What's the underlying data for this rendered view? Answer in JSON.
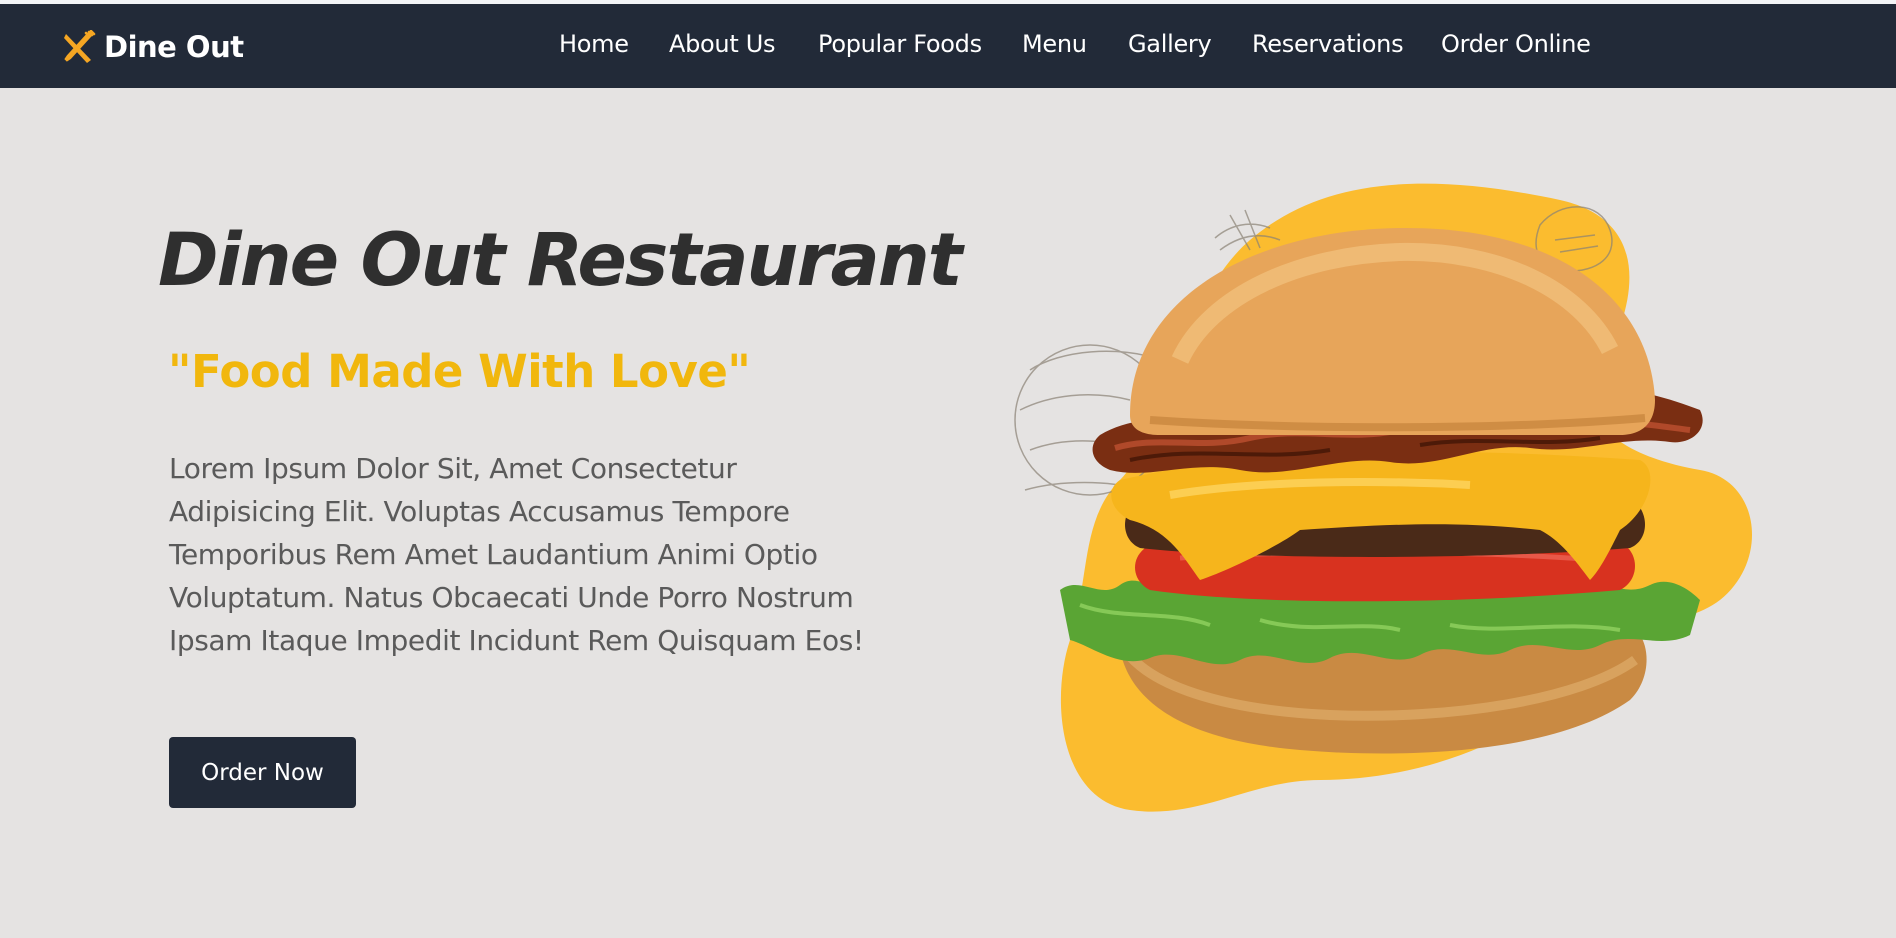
{
  "brand": {
    "name": "Dine Out",
    "icon": "fork-knife-icon",
    "icon_color": "#f5a623"
  },
  "nav": {
    "items": [
      {
        "label": "Home"
      },
      {
        "label": "About Us"
      },
      {
        "label": "Popular Foods"
      },
      {
        "label": "Menu"
      },
      {
        "label": "Gallery"
      },
      {
        "label": "Reservations"
      },
      {
        "label": "Order Online"
      }
    ]
  },
  "hero": {
    "title": "Dine Out Restaurant",
    "tagline": "\"Food Made With Love\"",
    "description": "Lorem Ipsum Dolor Sit, Amet Consectetur Adipisicing Elit. Voluptas Accusamus Tempore Temporibus Rem Amet Laudantium Animi Optio Voluptatum. Natus Obcaecati Unde Porro Nostrum Ipsam Itaque Impedit Incidunt Rem Quisquam Eos!",
    "cta_label": "Order Now",
    "image": "burger-image"
  },
  "colors": {
    "navbar": "#222a38",
    "background": "#e5e3e2",
    "accent": "#f1b70d",
    "title": "#2f2f2f",
    "body_text": "#5a5a5a",
    "blob": "#fbbc2f"
  }
}
